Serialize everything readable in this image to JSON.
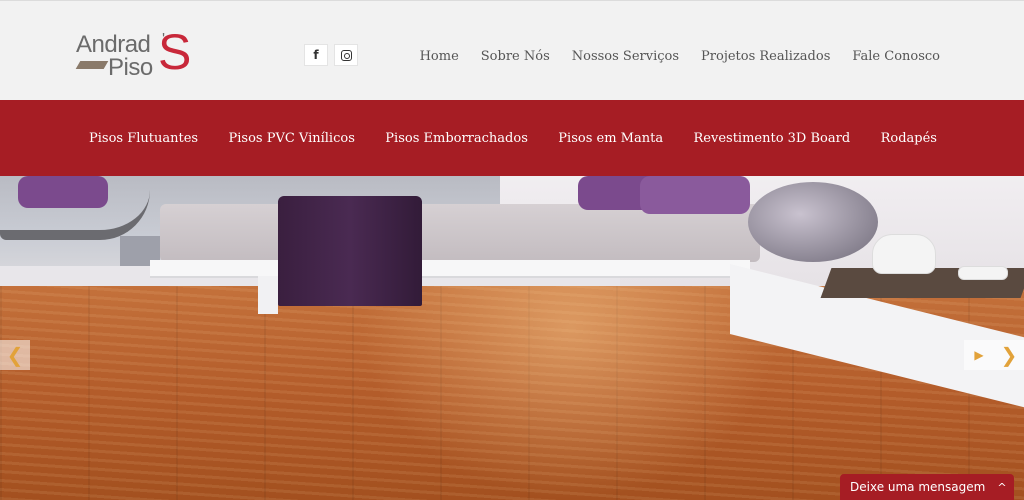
{
  "logo": {
    "line1": "Andrad",
    "apostrophe": "'",
    "line2": "Piso",
    "big_letter": "S",
    "accent_color": "#c8283a"
  },
  "social": [
    {
      "name": "facebook-icon",
      "glyph": "f"
    },
    {
      "name": "instagram-icon"
    }
  ],
  "top_nav": [
    "Home",
    "Sobre Nós",
    "Nossos Serviços",
    "Projetos Realizados",
    "Fale Conosco"
  ],
  "categories": [
    "Pisos Flutuantes",
    "Pisos PVC Vinílicos",
    "Pisos Emborrachados",
    "Pisos em Manta",
    "Revestimento 3D Board",
    "Rodapés"
  ],
  "colors": {
    "brand_red": "#a61d24",
    "arrow": "#e2a23a"
  },
  "slider": {
    "prev_glyph": "❮",
    "next_glyph": "❯",
    "play_glyph": "▶"
  },
  "chat": {
    "label": "Deixe uma mensagem",
    "chevron": "^"
  }
}
